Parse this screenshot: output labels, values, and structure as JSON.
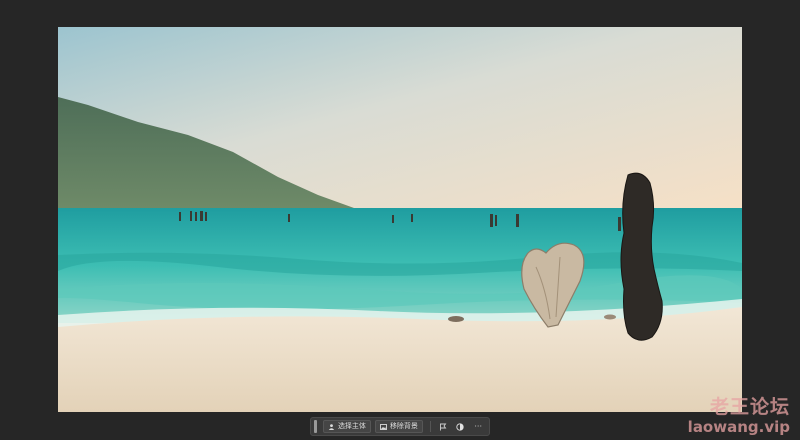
{
  "photo": {
    "subject": "beach-scene",
    "colors": {
      "sky_top": "#9cc4cf",
      "sky_bottom": "#f6e5cf",
      "sea": "#39bbb1",
      "sand": "#ece0cc"
    }
  },
  "taskbar": {
    "select_subject_label": "选择主体",
    "remove_background_label": "移除背景",
    "more_label": "···"
  },
  "watermark": {
    "cn": "老王论坛",
    "url": "laowang.vip"
  }
}
